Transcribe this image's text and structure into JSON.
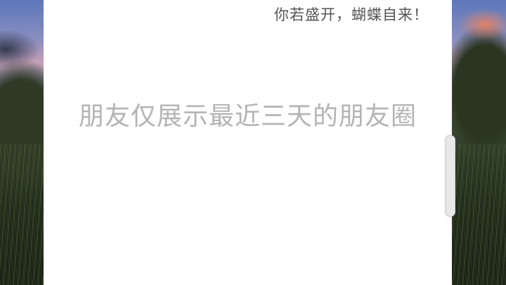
{
  "profile": {
    "signature": "你若盛开，蝴蝶自来！"
  },
  "moments": {
    "notice": "朋友仅展示最近三天的朋友圈"
  }
}
